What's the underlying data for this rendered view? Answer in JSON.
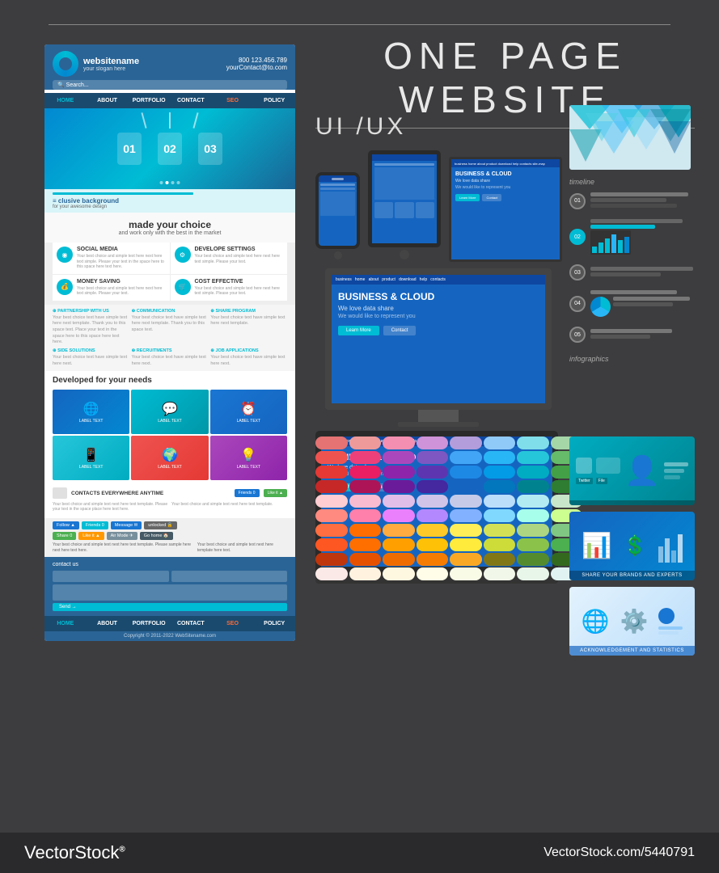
{
  "title": "ONE PAGE WEBSITE",
  "subtitle_line": "",
  "sections": {
    "uiux": "UI /UX",
    "timeline": "timeline",
    "infographics": "infographics"
  },
  "website_mockup": {
    "logo_name": "websitename",
    "logo_slogan": "your slogan here",
    "phone": "800 123.456.789",
    "email": "yourContact@to.com",
    "nav_items": [
      "HOME",
      "ABOUT",
      "PORTFOLIO",
      "CONTACT",
      "SEO",
      "POLICY"
    ],
    "hero_numbers": [
      "01",
      "02",
      "03"
    ],
    "tagline_main": "clusive background",
    "tagline_sub": "for your awesome design",
    "choice_title": "made your choice",
    "choice_sub": "and work only with the best in the market",
    "services": [
      {
        "title": "SOCIAL MEDIA",
        "desc": "Your best choice and simple text here simple text here text simple..."
      },
      {
        "title": "DEVELOPE SETTINGS",
        "desc": "Your best choice and simple text here simple text here text simple..."
      },
      {
        "title": "MONEY SAVING",
        "desc": "Your best choice and simple text here simple text here text simple..."
      },
      {
        "title": "COST EFFECTIVE",
        "desc": "Your best choice and simple text here simple text here text simple..."
      }
    ],
    "links": [
      {
        "title": "PARTNERSHIP WITH US",
        "desc": "Your best choice text here"
      },
      {
        "title": "COMMUNICATION",
        "desc": "Your best choice text here"
      },
      {
        "title": "SHARE PROGRAM",
        "desc": "Your best choice text here"
      },
      {
        "title": "SIDE SOLUTIONS",
        "desc": "Your best choice text here"
      },
      {
        "title": "RECRUITMENTS",
        "desc": "Your best choice text here"
      },
      {
        "title": "JOB APPLICATIONS",
        "desc": "Your best choice text here"
      }
    ],
    "developed_title": "Developed for your needs",
    "contacts_title": "CONTACTS EVERYWHERE ANYTIME",
    "social_buttons": [
      "Follow",
      "Friends",
      "Message",
      "unlocked",
      "Share",
      "Like it",
      "Air Mode",
      "Go home"
    ],
    "form_label": "contact us",
    "nav_bottom": [
      "HOME",
      "ABOUT",
      "PORTFOLIO",
      "CONTACT",
      "SEO",
      "POLICY"
    ],
    "copyright": "Copyright © 2011-2022 WebSitename.com",
    "screen_title": "BUSINESS & CLOUD",
    "screen_subtitle": "We love data share",
    "screen_body": "We would like to represent you"
  },
  "timeline_items": [
    {
      "num": "01",
      "active": false
    },
    {
      "num": "02",
      "active": true
    },
    {
      "num": "03",
      "active": false
    },
    {
      "num": "04",
      "active": false
    },
    {
      "num": "05",
      "active": false
    }
  ],
  "small_cards": [
    {
      "label": "",
      "type": "teal"
    },
    {
      "label": "SHARE YOUR BRANDS AND EXPERTS",
      "type": "blue"
    },
    {
      "label": "ACKNOWLEDGEMENT AND STATISTICS",
      "type": "light"
    }
  ],
  "footer": {
    "brand": "VectorStock",
    "trademark": "®",
    "url": "VectorStock.com/5440791"
  },
  "swatch_rows": [
    [
      "#e57373",
      "#ef9a9a",
      "#f48fb1",
      "#ce93d8",
      "#b39ddb",
      "#90caf9",
      "#80deea",
      "#a5d6a7"
    ],
    [
      "#ef5350",
      "#ec407a",
      "#ab47bc",
      "#7e57c2",
      "#42a5f5",
      "#29b6f6",
      "#26c6da",
      "#66bb6a"
    ],
    [
      "#e53935",
      "#e91e63",
      "#8e24aa",
      "#5e35b1",
      "#1e88e5",
      "#039be5",
      "#00acc1",
      "#43a047"
    ],
    [
      "#c62828",
      "#ad1457",
      "#6a1b9a",
      "#4527a0",
      "#1565c0",
      "#0277bd",
      "#00838f",
      "#2e7d32"
    ],
    [
      "#ffcdd2",
      "#f8bbd0",
      "#e1bee7",
      "#d1c4e9",
      "#c5cae9",
      "#bbdefb",
      "#b2ebf2",
      "#c8e6c9"
    ],
    [
      "#ff8a80",
      "#ff80ab",
      "#ea80fc",
      "#b388ff",
      "#82b1ff",
      "#80d8ff",
      "#a7ffeb",
      "#ccff90"
    ],
    [
      "#ff6e40",
      "#ff6d00",
      "#ffab40",
      "#ffca28",
      "#ffee58",
      "#d4e157",
      "#aed581",
      "#81c784"
    ],
    [
      "#ff5722",
      "#ff6f00",
      "#ffa000",
      "#ffc107",
      "#ffeb3b",
      "#cddc39",
      "#8bc34a",
      "#4caf50"
    ],
    [
      "#bf360c",
      "#e65100",
      "#ef6c00",
      "#f57c00",
      "#f9a825",
      "#827717",
      "#558b2f",
      "#33691e"
    ],
    [
      "#fbe9e7",
      "#fff3e0",
      "#fff8e1",
      "#fffde7",
      "#f9fbe7",
      "#f1f8e9",
      "#e8f5e9",
      "#e0f2f1"
    ]
  ]
}
